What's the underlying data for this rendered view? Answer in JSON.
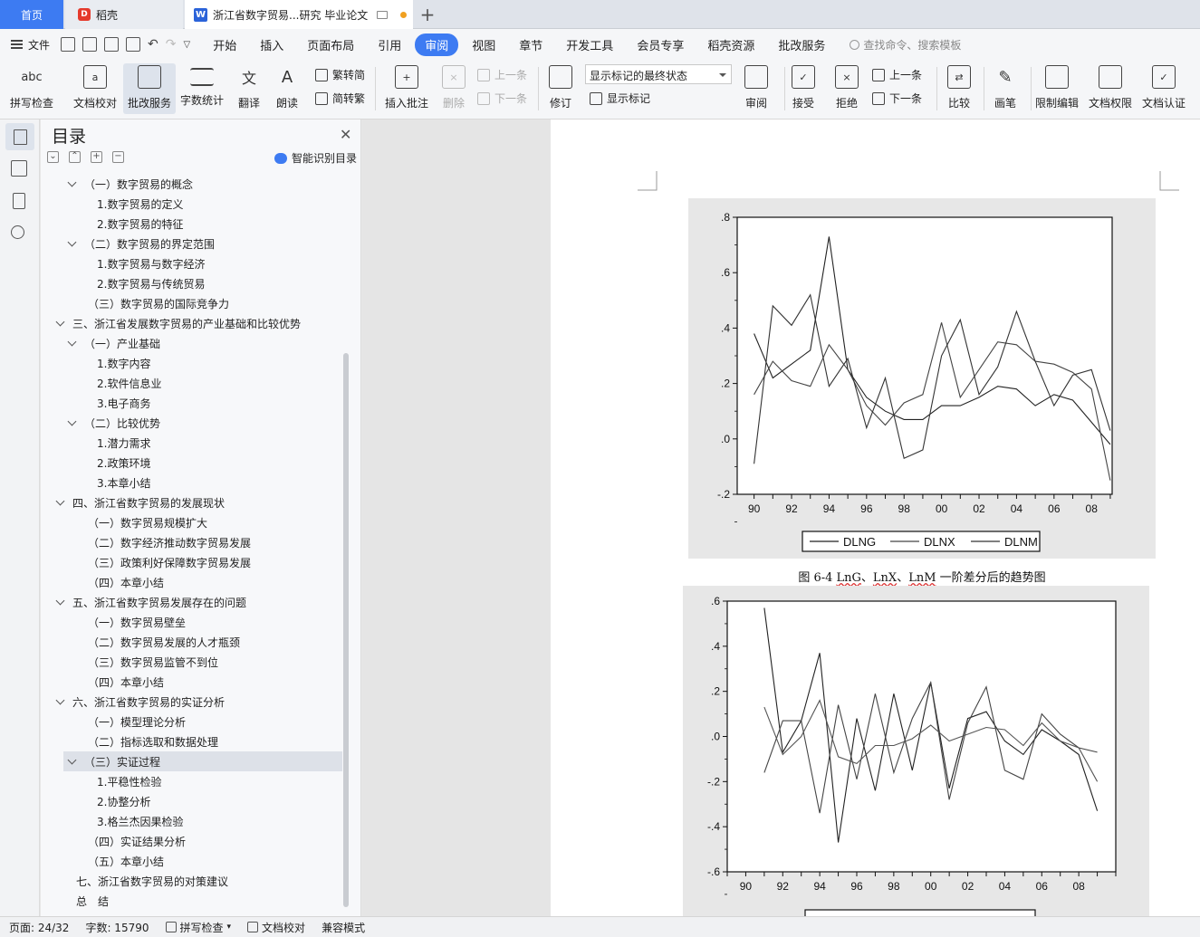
{
  "tabs": {
    "home": "首页",
    "wps": "稻壳",
    "doc": "浙江省数字贸易...研究 毕业论文"
  },
  "menu": {
    "file": "文件",
    "items": [
      "开始",
      "插入",
      "页面布局",
      "引用",
      "审阅",
      "视图",
      "章节",
      "开发工具",
      "会员专享",
      "稻壳资源",
      "批改服务"
    ],
    "active": "审阅",
    "search_placeholder": "查找命令、搜索模板"
  },
  "ribbon": {
    "spell": "拼写检查",
    "spell_glyph": "abc",
    "proof": "文档校对",
    "correct": "批改服务",
    "count": "字数统计",
    "translate": "翻译",
    "read": "朗读",
    "t2s": "繁转简",
    "s2t": "简转繁",
    "insert_comment": "插入批注",
    "delete": "删除",
    "prev": "上一条",
    "next": "下一条",
    "track": "修订",
    "markup_state": "显示标记的最终状态",
    "show_markup": "显示标记",
    "review": "审阅",
    "accept": "接受",
    "reject": "拒绝",
    "prev2": "上一条",
    "next2": "下一条",
    "compare": "比较",
    "pen": "画笔",
    "restrict": "限制编辑",
    "perm": "文档权限",
    "cert": "文档认证"
  },
  "toc": {
    "title": "目录",
    "smart": "智能识别目录",
    "items": [
      {
        "text": "（一）数字贸易的概念",
        "level": 1,
        "caret": true
      },
      {
        "text": "1.数字贸易的定义",
        "level": 2,
        "caret": false
      },
      {
        "text": "2.数字贸易的特征",
        "level": 2,
        "caret": false
      },
      {
        "text": "（二）数字贸易的界定范围",
        "level": 1,
        "caret": true
      },
      {
        "text": "1.数字贸易与数字经济",
        "level": 2,
        "caret": false
      },
      {
        "text": "2.数字贸易与传统贸易",
        "level": 2,
        "caret": false
      },
      {
        "text": "（三）数字贸易的国际竞争力",
        "level": 1,
        "caret": false
      },
      {
        "text": "三、浙江省发展数字贸易的产业基础和比较优势",
        "level": 0,
        "caret": true
      },
      {
        "text": "（一）产业基础",
        "level": 1,
        "caret": true
      },
      {
        "text": "1.数字内容",
        "level": 2,
        "caret": false
      },
      {
        "text": "2.软件信息业",
        "level": 2,
        "caret": false
      },
      {
        "text": "3.电子商务",
        "level": 2,
        "caret": false
      },
      {
        "text": "（二）比较优势",
        "level": 1,
        "caret": true
      },
      {
        "text": "1.潜力需求",
        "level": 2,
        "caret": false
      },
      {
        "text": "2.政策环境",
        "level": 2,
        "caret": false
      },
      {
        "text": "3.本章小结",
        "level": 2,
        "caret": false
      },
      {
        "text": "四、浙江省数字贸易的发展现状",
        "level": 0,
        "caret": true
      },
      {
        "text": "（一）数字贸易规模扩大",
        "level": 1,
        "caret": false
      },
      {
        "text": "（二）数字经济推动数字贸易发展",
        "level": 1,
        "caret": false
      },
      {
        "text": "（三）政策利好保障数字贸易发展",
        "level": 1,
        "caret": false
      },
      {
        "text": "（四）本章小结",
        "level": 1,
        "caret": false
      },
      {
        "text": "五、浙江省数字贸易发展存在的问题",
        "level": 0,
        "caret": true
      },
      {
        "text": "（一）数字贸易壁垒",
        "level": 1,
        "caret": false
      },
      {
        "text": "（二）数字贸易发展的人才瓶颈",
        "level": 1,
        "caret": false
      },
      {
        "text": "（三）数字贸易监管不到位",
        "level": 1,
        "caret": false
      },
      {
        "text": "（四）本章小结",
        "level": 1,
        "caret": false
      },
      {
        "text": "六、浙江省数字贸易的实证分析",
        "level": 0,
        "caret": true
      },
      {
        "text": "（一）模型理论分析",
        "level": 1,
        "caret": false
      },
      {
        "text": "（二）指标选取和数据处理",
        "level": 1,
        "caret": false
      },
      {
        "text": "（三）实证过程",
        "level": 1,
        "caret": true,
        "selected": true
      },
      {
        "text": "1.平稳性检验",
        "level": 2,
        "caret": false
      },
      {
        "text": "2.协整分析",
        "level": 2,
        "caret": false
      },
      {
        "text": "3.格兰杰因果检验",
        "level": 2,
        "caret": false
      },
      {
        "text": "（四）实证结果分析",
        "level": 1,
        "caret": false
      },
      {
        "text": "（五）本章小结",
        "level": 1,
        "caret": false
      },
      {
        "text": "七、浙江省数字贸易的对策建议",
        "level": 0,
        "caret": false
      },
      {
        "text": "总　结",
        "level": 0,
        "caret": false
      }
    ]
  },
  "figure_caption": {
    "prefix": "图 6-4 ",
    "v1": "LnG",
    "sep1": "、",
    "v2": "LnX",
    "sep2": "、",
    "v3": "LnM",
    "suffix": " 一阶差分后的趋势图"
  },
  "chart_data": [
    {
      "type": "line",
      "x": [
        1990,
        1991,
        1992,
        1993,
        1994,
        1995,
        1996,
        1997,
        1998,
        1999,
        2000,
        2001,
        2002,
        2003,
        2004,
        2005,
        2006,
        2007,
        2008,
        2009
      ],
      "xticks": [
        "90",
        "92",
        "94",
        "96",
        "98",
        "00",
        "02",
        "04",
        "06",
        "08"
      ],
      "yticks": [
        ".8",
        ".6",
        ".4",
        ".2",
        ".0",
        "-.2"
      ],
      "ylim": [
        -0.2,
        0.8
      ],
      "legend": [
        "DLNG",
        "DLNX",
        "DLNM"
      ],
      "legend_position": "bottom",
      "series": [
        {
          "name": "DLNG",
          "values": [
            0.38,
            0.22,
            0.27,
            0.32,
            0.73,
            0.25,
            0.15,
            0.1,
            0.07,
            0.07,
            0.12,
            0.12,
            0.15,
            0.19,
            0.18,
            0.12,
            0.16,
            0.14,
            0.06,
            -0.02
          ]
        },
        {
          "name": "DLNX",
          "values": [
            0.16,
            0.28,
            0.21,
            0.19,
            0.34,
            0.25,
            0.12,
            0.05,
            0.13,
            0.16,
            0.42,
            0.15,
            0.25,
            0.35,
            0.34,
            0.28,
            0.27,
            0.24,
            0.18,
            -0.15
          ]
        },
        {
          "name": "DLNM",
          "values": [
            -0.09,
            0.48,
            0.41,
            0.52,
            0.19,
            0.29,
            0.04,
            0.22,
            -0.07,
            -0.04,
            0.3,
            0.43,
            0.16,
            0.26,
            0.46,
            0.28,
            0.12,
            0.23,
            0.25,
            0.03
          ]
        }
      ]
    },
    {
      "type": "line",
      "x": [
        1991,
        1992,
        1993,
        1994,
        1995,
        1996,
        1997,
        1998,
        1999,
        2000,
        2001,
        2002,
        2003,
        2004,
        2005,
        2006,
        2007,
        2008,
        2009
      ],
      "xticks": [
        "90",
        "92",
        "94",
        "96",
        "98",
        "00",
        "02",
        "04",
        "06",
        "08"
      ],
      "yticks": [
        ".6",
        ".4",
        ".2",
        ".0",
        "-.2",
        "-.4",
        "-.6"
      ],
      "ylim": [
        -0.6,
        0.6
      ],
      "series": [
        {
          "values": [
            0.57,
            -0.07,
            0.07,
            0.37,
            -0.47,
            0.08,
            -0.24,
            0.19,
            -0.15,
            0.24,
            -0.23,
            0.08,
            0.11,
            -0.02,
            -0.08,
            0.03,
            -0.02,
            -0.08,
            -0.33
          ]
        },
        {
          "values": [
            -0.16,
            0.07,
            0.07,
            -0.34,
            0.14,
            -0.19,
            0.19,
            -0.16,
            0.08,
            0.24,
            -0.28,
            0.06,
            0.22,
            -0.15,
            -0.19,
            0.1,
            0.01,
            -0.05,
            -0.07
          ]
        },
        {
          "values": [
            0.13,
            -0.08,
            0.0,
            0.16,
            -0.09,
            -0.12,
            -0.04,
            -0.04,
            -0.01,
            0.05,
            -0.02,
            0.01,
            0.04,
            0.03,
            -0.04,
            0.06,
            -0.02,
            -0.05,
            -0.2
          ]
        }
      ]
    }
  ],
  "status": {
    "page": "页面: 24/32",
    "words": "字数: 15790",
    "spell": "拼写检查",
    "proof": "文档校对",
    "compat": "兼容模式"
  }
}
